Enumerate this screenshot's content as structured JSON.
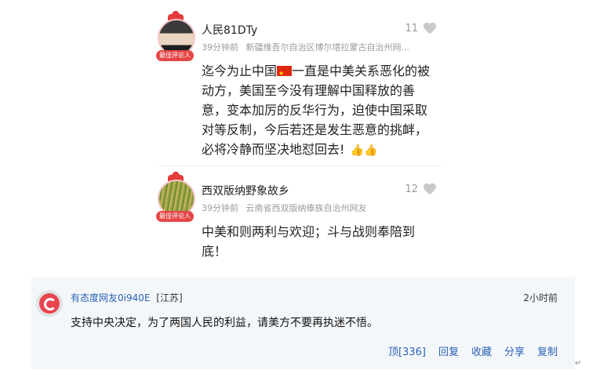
{
  "comments": [
    {
      "name": "人民81DTy",
      "likes": "11",
      "time": "39分钟前",
      "location": "新疆维吾尔自治区博尔塔拉蒙古自治州网...",
      "badge": "最佳评论人",
      "text_a": "迄今为止中国",
      "text_b": "一直是中美关系恶化的被动方，美国至今没有理解中国释放的善意，变本加厉的反华行为，迫使中国采取对等反制，今后若还是发生恶意的挑衅，必将冷静而坚决地怼回去!",
      "emoji": "👍👍"
    },
    {
      "name": "西双版纳野象故乡",
      "likes": "12",
      "time": "39分钟前",
      "location": "云南省西双版纳傣族自治州网友",
      "badge": "最佳评论人",
      "text": "中美和则两利与欢迎；斗与战则奉陪到底！"
    }
  ],
  "forum_post": {
    "nickname": "有态度网友0i940E",
    "region": "[江苏]",
    "time": "2小时前",
    "text": "支持中央决定，为了两国人民的利益，请美方不要再执迷不悟。",
    "actions": {
      "top": "顶[336]",
      "reply": "回复",
      "collect": "收藏",
      "share": "分享",
      "copy": "复制"
    }
  },
  "enter_mark": "↵",
  "colors": {
    "accent_red": "#e54646",
    "link_blue": "#2a62b5",
    "bottom_bg": "#f4f7fa"
  }
}
